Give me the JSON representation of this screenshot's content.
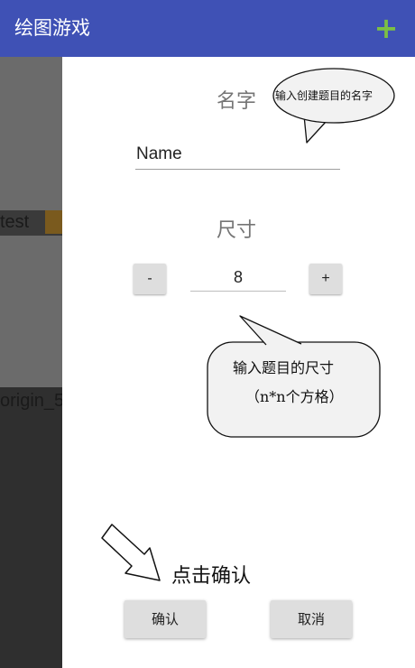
{
  "app_bar": {
    "title": "绘图游戏",
    "add_icon": "plus-icon",
    "add_color": "#7cc043",
    "bg_color": "#3f51b5"
  },
  "background_list": {
    "items": [
      {
        "label": "test"
      },
      {
        "label": "origin_5"
      }
    ]
  },
  "dialog": {
    "name_label": "名字",
    "name_input": {
      "value": "Name"
    },
    "size_label": "尺寸",
    "minus_label": "-",
    "plus_label": "+",
    "size_value": "8",
    "confirm_label": "确认",
    "cancel_label": "取消"
  },
  "annotations": {
    "name_hint": "输入创建题目的名字",
    "size_hint_line1": "输入题目的尺寸",
    "size_hint_line2": "（n*n个方格）",
    "confirm_hint": "点击确认"
  }
}
